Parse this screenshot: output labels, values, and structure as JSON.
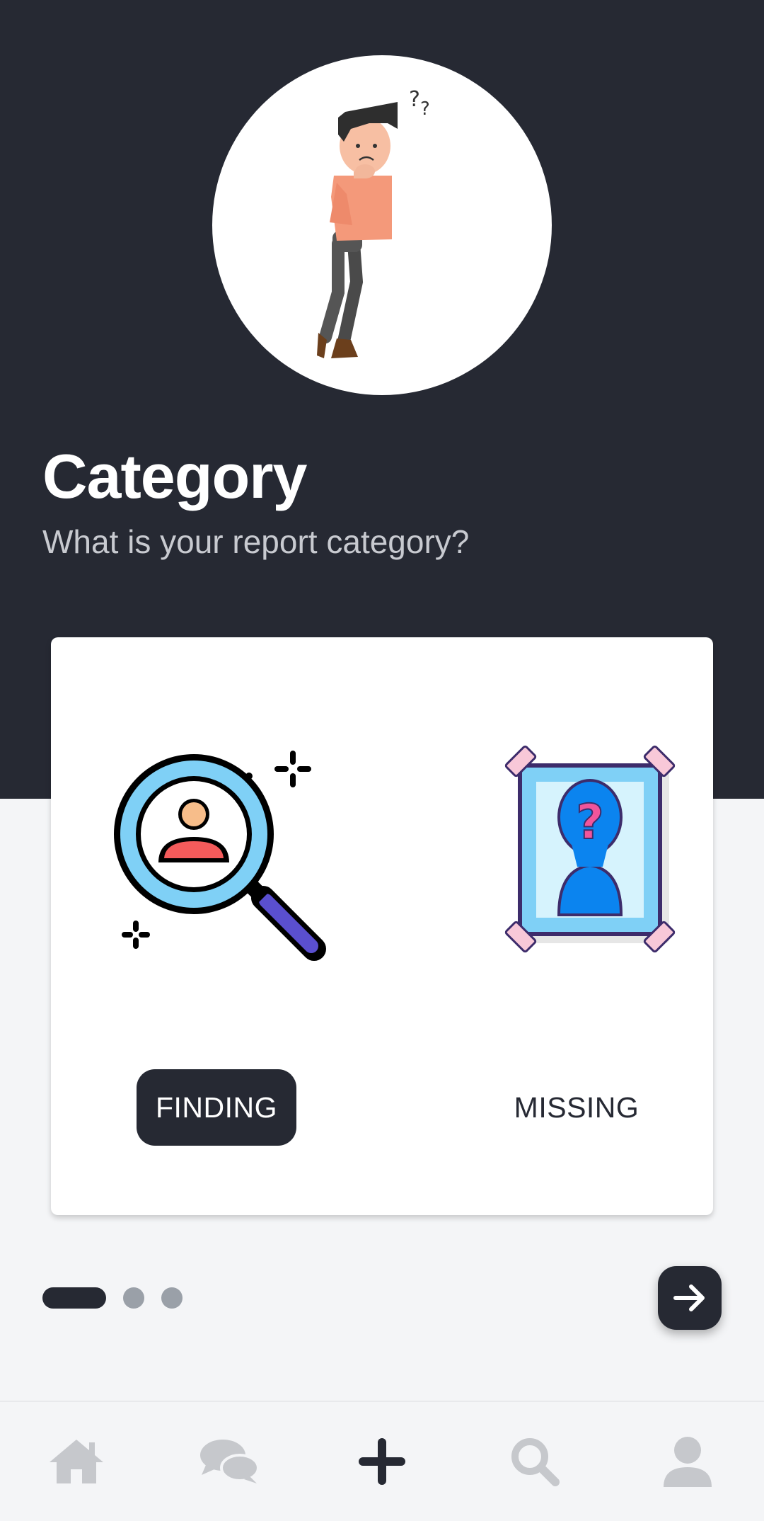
{
  "header": {
    "title": "Category",
    "subtitle": "What is your report category?"
  },
  "options": [
    {
      "label": "FINDING",
      "icon": "magnifier-person-icon",
      "selected": true
    },
    {
      "label": "MISSING",
      "icon": "missing-poster-icon",
      "selected": false
    }
  ],
  "pager": {
    "total": 3,
    "current": 1
  },
  "nav": [
    "home-icon",
    "chat-icon",
    "plus-icon",
    "search-icon",
    "profile-icon"
  ],
  "colors": {
    "dark": "#262933",
    "background": "#f4f5f7",
    "nav_inactive": "#c6c8cc",
    "accent_blue": "#0b84ef",
    "accent_light_blue": "#7fd0f6"
  }
}
